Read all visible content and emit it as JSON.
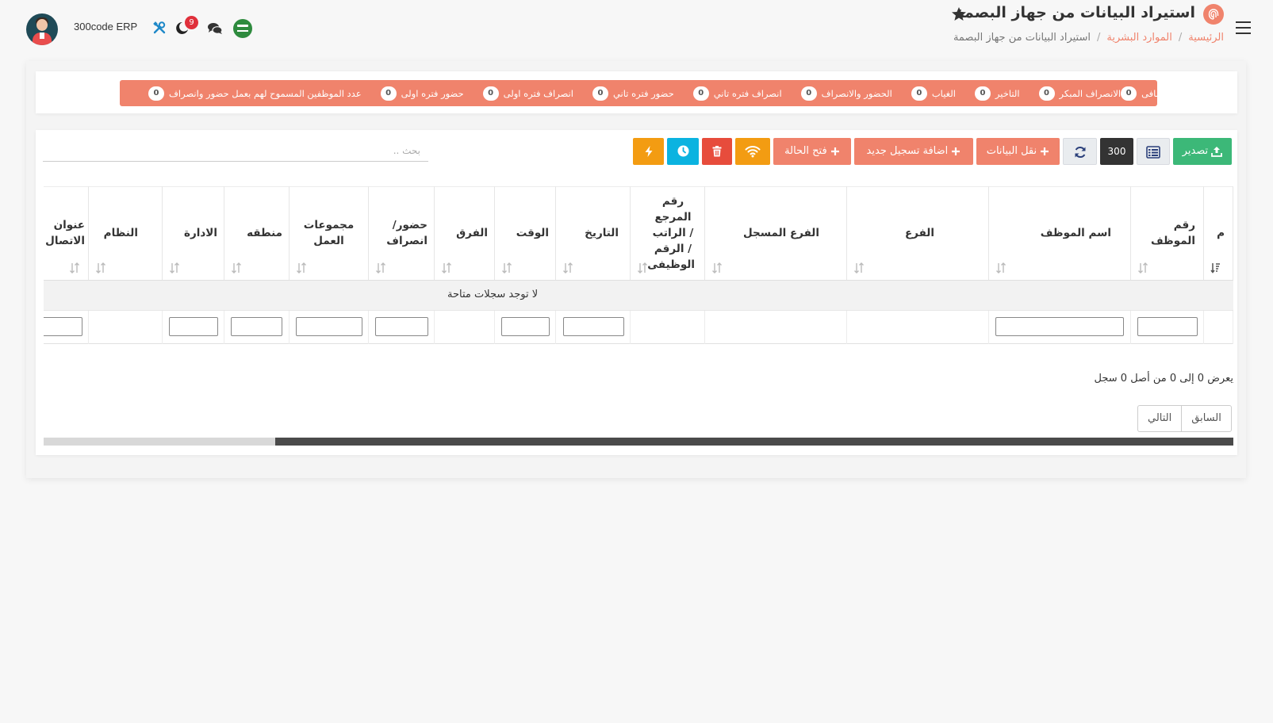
{
  "header": {
    "app_name": "300code ERP",
    "notifications_count": "9",
    "page_title": "استيراد البيانات من جهاز البصمة",
    "breadcrumb": [
      "الرئيسية",
      "الموارد البشرية",
      "استيراد البيانات من جهاز البصمة"
    ]
  },
  "stats": [
    {
      "label": "عدد الموظفين المسموح لهم بعمل حضور وانصراف",
      "count": "0"
    },
    {
      "label": "حضور فتره اولى",
      "count": "0"
    },
    {
      "label": "انصراف فتره اولى",
      "count": "0"
    },
    {
      "label": "حضور فتره تاني",
      "count": "0"
    },
    {
      "label": "انصراف فتره تاني",
      "count": "0"
    },
    {
      "label": "الحضور والانصراف",
      "count": "0"
    },
    {
      "label": "الغياب",
      "count": "0"
    },
    {
      "label": "التاخير",
      "count": "0"
    },
    {
      "label": "الانصراف المبكر",
      "count": "0"
    },
    {
      "label": "الاضافى",
      "count": "0"
    }
  ],
  "toolbar": {
    "export_label": "تصدير",
    "page_size": "300",
    "transfer_label": "نقل البيانات",
    "add_label": "اضافة تسجيل جديد",
    "status_label": "فتح الحالة",
    "search_placeholder": "بحث .."
  },
  "table": {
    "columns": [
      "م",
      "رقم الموظف",
      "اسم الموظف",
      "الفرع",
      "الفرع المسجل",
      "رقم المرجع / الراتب / الرقم الوظيفى",
      "التاريخ",
      "الوقت",
      "الفرق",
      "حضور/ انصراف",
      "مجموعات العمل",
      "منطقه",
      "الادارة",
      "النظام",
      "عنوان الاتصال"
    ],
    "empty_text": "لا توجد سجلات متاحة"
  },
  "footer": {
    "info": "يعرض 0 إلى 0 من أصل 0 سجل",
    "prev_label": "السابق",
    "next_label": "التالي"
  },
  "colors": {
    "accent": "#f0836c",
    "success": "#3cb878",
    "warning": "#f39c12",
    "danger": "#e74c3c",
    "info": "#0bb3e0"
  }
}
